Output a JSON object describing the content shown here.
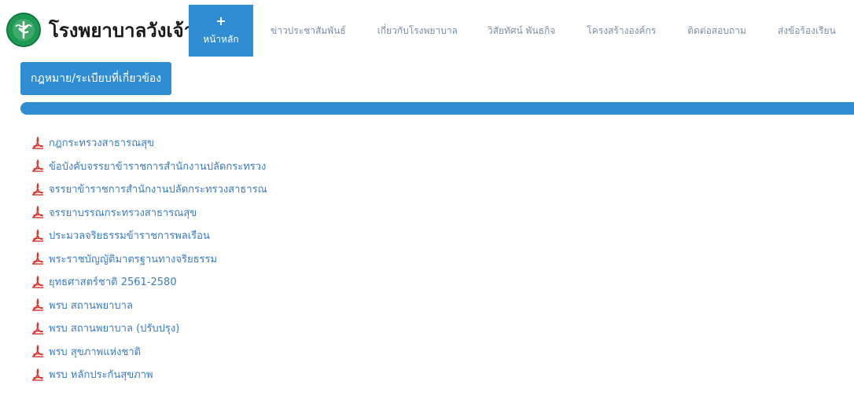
{
  "site": {
    "title": "โรงพยาบาลวังเจ้า"
  },
  "nav": {
    "home_icon": "+",
    "items": [
      {
        "label": "หน้าหลัก",
        "active": true
      },
      {
        "label": "ข่าวประชาสัมพันธ์",
        "active": false
      },
      {
        "label": "เกี่ยวกับโรงพยาบาล",
        "active": false
      },
      {
        "label": "วิสัยทัศน์ พันธกิจ",
        "active": false
      },
      {
        "label": "โครงสร้างองค์กร",
        "active": false
      },
      {
        "label": "ติดต่อสอบถาม",
        "active": false
      },
      {
        "label": "ส่งข้อร้องเรียน",
        "active": false
      }
    ]
  },
  "section": {
    "title": "กฎหมาย/ระเบียบที่เกี่ยวข้อง"
  },
  "documents": [
    {
      "label": "กฎกระทรวงสาธารณสุข",
      "icon": "pdf-icon"
    },
    {
      "label": "ข้อบังคับจรรยาข้าราชการสำนักงานปลัดกระทรวง",
      "icon": "pdf-icon"
    },
    {
      "label": "จรรยาข้าราชการสำนักงานปลัดกระทรวงสาธารณ",
      "icon": "pdf-icon"
    },
    {
      "label": "จรรยาบรรณกระทรวงสาธารณสุข",
      "icon": "pdf-icon"
    },
    {
      "label": "ประมวลจริยธรรมข้าราชการพลเรือน",
      "icon": "pdf-icon"
    },
    {
      "label": "พระราชบัญญัติมาตรฐานทางจริยธรรม",
      "icon": "pdf-icon"
    },
    {
      "label": "ยุทธศาสตร์ชาติ 2561-2580",
      "icon": "pdf-icon"
    },
    {
      "label": "พรบ สถานพยาบาล",
      "icon": "pdf-icon"
    },
    {
      "label": "พรบ สถานพยาบาล (ปรับปรุง)",
      "icon": "pdf-icon"
    },
    {
      "label": "พรบ สุขภาพแห่งชาติ",
      "icon": "pdf-icon"
    },
    {
      "label": "พรบ หลักประกันสุขภาพ",
      "icon": "pdf-icon"
    }
  ],
  "colors": {
    "primary": "#2f8ed3",
    "link": "#3a7cc2",
    "nav_text": "#7a8fa8",
    "logo_green": "#1d9a52",
    "pdf_red": "#d9342b"
  }
}
